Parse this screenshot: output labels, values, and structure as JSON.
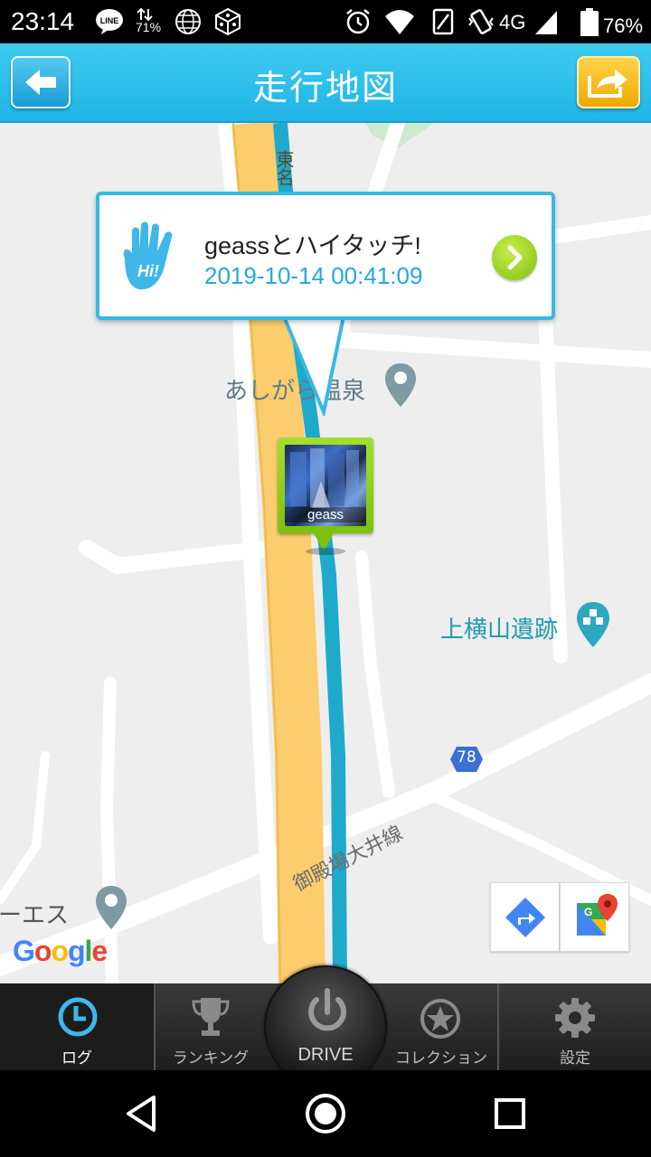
{
  "status_bar": {
    "time": "23:14",
    "network": "4G",
    "battery": "76%",
    "speed_badge": "71%",
    "icons": [
      "line-icon",
      "data-speed-icon",
      "globe-icon",
      "dice-icon",
      "alarm-icon",
      "wifi-icon",
      "sim-icon",
      "vibrate-icon",
      "signal-icon",
      "battery-icon"
    ]
  },
  "header": {
    "title": "走行地図",
    "back_icon": "arrow-left-icon",
    "share_icon": "share-arrow-icon"
  },
  "popup": {
    "title": "geassとハイタッチ!",
    "timestamp": "2019-10-14 00:41:09",
    "icon": "hi-five-hand-icon",
    "next_icon": "chevron-right-icon"
  },
  "map": {
    "places": {
      "onsen": "あしがら温泉",
      "ruins": "上横山遺跡",
      "shop": "ーエス"
    },
    "road_labels": {
      "expressway": "東名",
      "route": "御殿場大井線",
      "route_number": "78"
    },
    "marker_name": "geass",
    "google_logo": [
      "G",
      "o",
      "o",
      "g",
      "l",
      "e"
    ],
    "google_colors": [
      "#4285F4",
      "#EA4335",
      "#FBBC05",
      "#4285F4",
      "#34A853",
      "#EA4335"
    ],
    "route_color": "#1eaacb",
    "expressway_color": "#fbcd6e",
    "buttons": {
      "directions_icon": "directions-icon",
      "maps_icon": "google-maps-icon"
    }
  },
  "tabbar": {
    "tabs": [
      {
        "label": "ログ",
        "icon": "clock-icon",
        "active": true
      },
      {
        "label": "ランキング",
        "icon": "trophy-icon",
        "active": false
      },
      {
        "label": "DRIVE",
        "icon": "power-icon",
        "active": false
      },
      {
        "label": "コレクション",
        "icon": "star-icon",
        "active": false
      },
      {
        "label": "設定",
        "icon": "gear-icon",
        "active": false
      }
    ]
  },
  "navbar": {
    "icons": [
      "back-triangle-icon",
      "home-circle-icon",
      "recents-square-icon"
    ]
  }
}
